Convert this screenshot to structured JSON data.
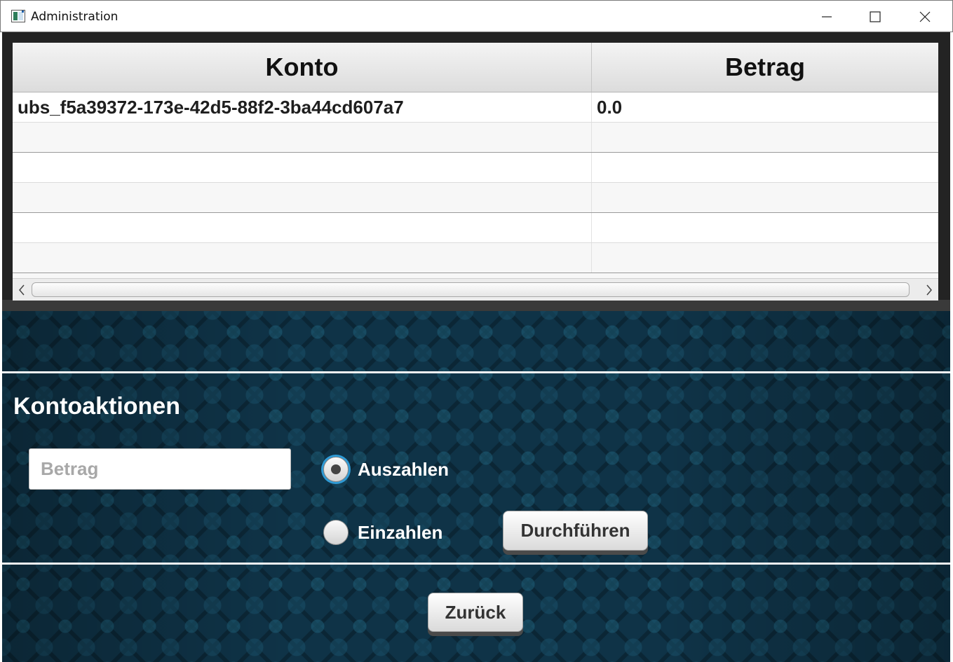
{
  "window": {
    "title": "Administration",
    "controls": [
      "minimize",
      "maximize",
      "close"
    ]
  },
  "table": {
    "columns": [
      "Konto",
      "Betrag"
    ],
    "rows": [
      {
        "konto": "ubs_f5a39372-173e-42d5-88f2-3ba44cd607a7",
        "betrag": "0.0"
      }
    ]
  },
  "actions": {
    "title": "Kontoaktionen",
    "amount_placeholder": "Betrag",
    "amount_value": "",
    "options": [
      {
        "label": "Auszahlen",
        "selected": true
      },
      {
        "label": "Einzahlen",
        "selected": false
      }
    ],
    "execute_label": "Durchführen"
  },
  "footer": {
    "back_label": "Zurück"
  },
  "colors": {
    "background": "#0f3347",
    "radio_focus": "#2f9bd6",
    "separator": "#f2f2f2"
  }
}
